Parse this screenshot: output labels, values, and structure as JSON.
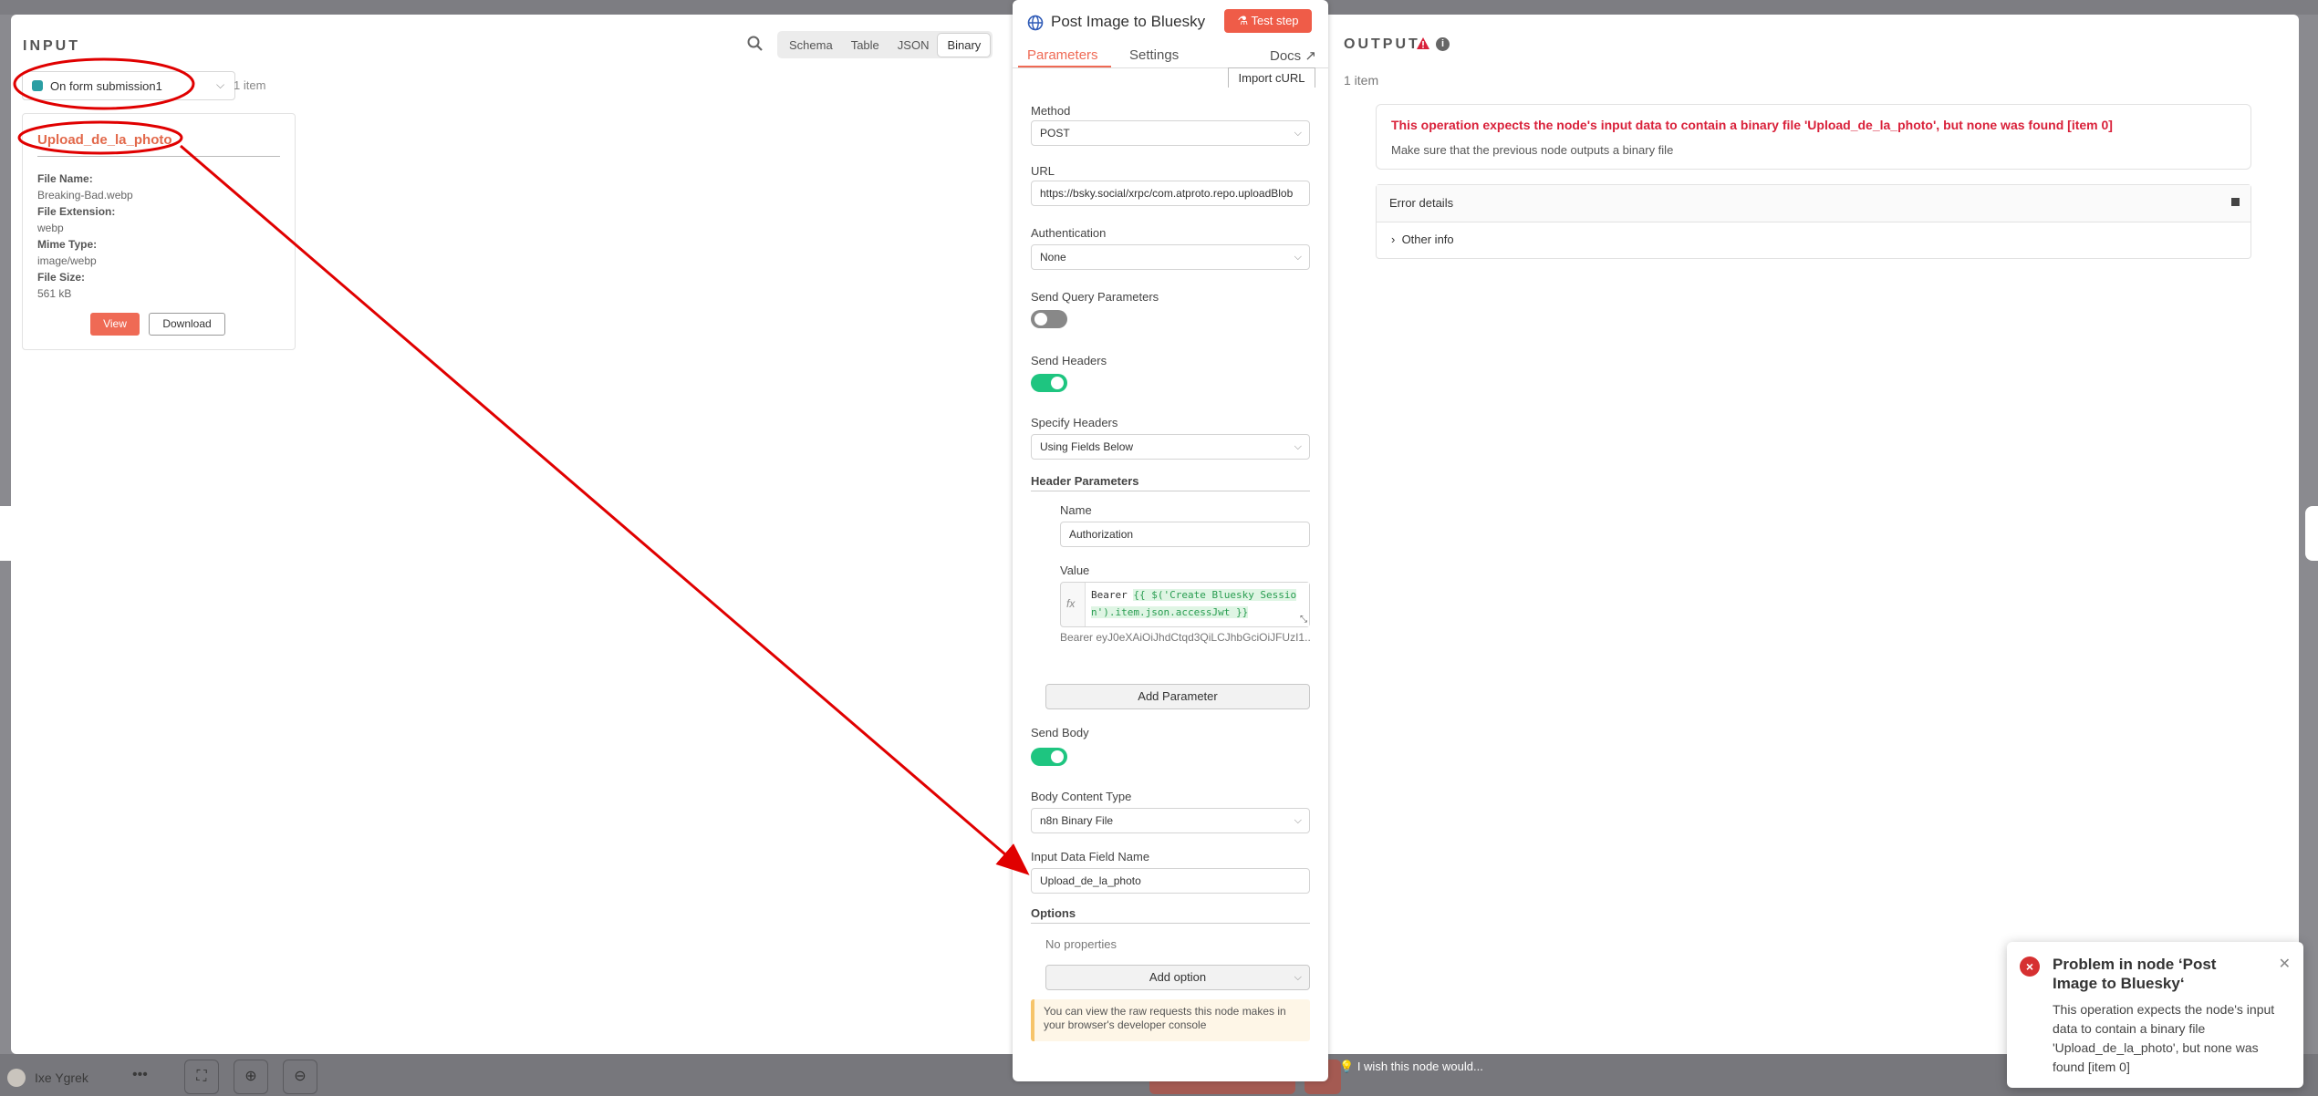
{
  "background": {
    "user_name": "Ixe Ygrek",
    "bottom_hint": "I wish this node would..."
  },
  "input": {
    "title": "INPUT",
    "node_select": "On form submission1",
    "item_count": "1 item",
    "mode_tabs": [
      "Schema",
      "Table",
      "JSON",
      "Binary"
    ],
    "active_mode": "Binary",
    "binary": {
      "key": "Upload_de_la_photo",
      "file_name_label": "File Name:",
      "file_name": "Breaking-Bad.webp",
      "file_ext_label": "File Extension:",
      "file_ext": "webp",
      "mime_label": "Mime Type:",
      "mime": "image/webp",
      "size_label": "File Size:",
      "size": "561 kB",
      "view_label": "View",
      "download_label": "Download"
    }
  },
  "node": {
    "title": "Post Image to Bluesky",
    "test_step": "Test step",
    "tabs": {
      "parameters": "Parameters",
      "settings": "Settings",
      "docs": "Docs"
    },
    "import_curl": "Import cURL",
    "method_label": "Method",
    "method": "POST",
    "url_label": "URL",
    "url": "https://bsky.social/xrpc/com.atproto.repo.uploadBlob",
    "auth_label": "Authentication",
    "auth": "None",
    "send_query_label": "Send Query Parameters",
    "send_query": false,
    "send_headers_label": "Send Headers",
    "send_headers": true,
    "specify_headers_label": "Specify Headers",
    "specify_headers": "Using Fields Below",
    "header_params_label": "Header Parameters",
    "header_name_label": "Name",
    "header_name": "Authorization",
    "header_value_label": "Value",
    "header_value_prefix": "Bearer ",
    "header_value_expr_1": "{{ $('Create Bluesky Sessio",
    "header_value_expr_2": "n').item.json.accessJwt }}",
    "header_value_preview": "Bearer eyJ0eXAiOiJhdCtqd3QiLCJhbGciOiJFUzI1...",
    "add_parameter": "Add Parameter",
    "send_body_label": "Send Body",
    "send_body": true,
    "body_type_label": "Body Content Type",
    "body_type": "n8n Binary File",
    "input_field_label": "Input Data Field Name",
    "input_field": "Upload_de_la_photo",
    "options_label": "Options",
    "no_properties": "No properties",
    "add_option": "Add option",
    "notice": "You can view the raw requests this node makes in your browser's developer console"
  },
  "output": {
    "title": "OUTPUT",
    "item_count": "1 item",
    "error_message": "This operation expects the node's input data to contain a binary file 'Upload_de_la_photo', but none was found [item 0]",
    "error_desc": "Make sure that the previous node outputs a binary file",
    "error_details": "Error details",
    "other_info": "Other info"
  },
  "toast": {
    "title": "Problem in node ‘Post Image to Bluesky‘",
    "body": "This operation expects the node's input data to contain a binary file 'Upload_de_la_photo', but none was found [item 0]"
  },
  "colors": {
    "accent": "#ef6a55",
    "error": "#d9213a",
    "toggle_on": "#1ec580",
    "annotation": "#e00000"
  }
}
